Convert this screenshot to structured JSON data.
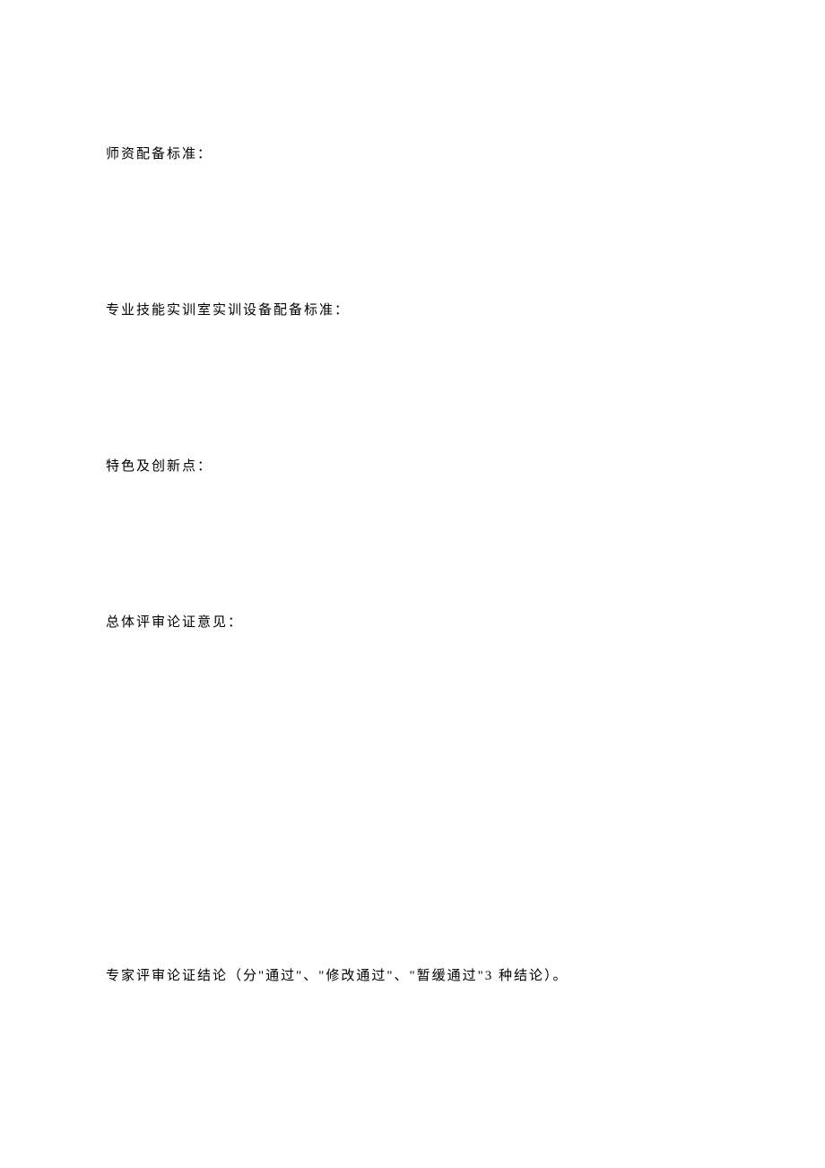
{
  "sections": {
    "label1": "师资配备标准：",
    "label2": "专业技能实训室实训设备配备标准：",
    "label3": "特色及创新点：",
    "label4": "总体评审论证意见：",
    "label5": "专家评审论证结论（分\"通过\"、\"修改通过\"、\"暂缓通过\"3 种结论）。"
  }
}
